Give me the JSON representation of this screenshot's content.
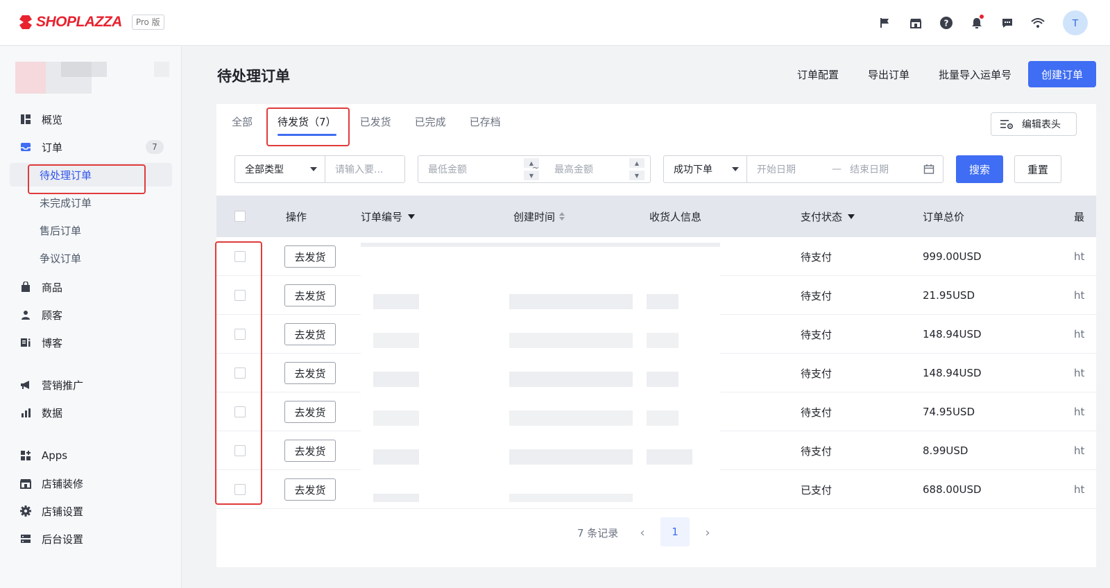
{
  "brand": {
    "name": "SHOPLAZZA",
    "edition": "Pro 版",
    "color": "#e8222f"
  },
  "topbar": {
    "icons": [
      "flag-icon",
      "store-icon",
      "help-icon",
      "bell-icon",
      "chat-icon",
      "wifi-icon"
    ],
    "avatar_letter": "T"
  },
  "sidebar": {
    "overview": "概览",
    "orders": "订单",
    "orders_count": "7",
    "orders_sub": [
      "待处理订单",
      "未完成订单",
      "售后订单",
      "争议订单"
    ],
    "products": "商品",
    "customers": "顾客",
    "blog": "博客",
    "marketing": "营销推广",
    "data": "数据",
    "apps": "Apps",
    "store_design": "店铺装修",
    "store_settings": "店铺设置",
    "admin_settings": "后台设置"
  },
  "page": {
    "title": "待处理订单",
    "actions": {
      "config": "订单配置",
      "export": "导出订单",
      "bulk_import": "批量导入运单号",
      "create": "创建订单"
    }
  },
  "tabs": [
    "全部",
    "待发货（7）",
    "已发货",
    "已完成",
    "已存档"
  ],
  "edit_columns": "编辑表头",
  "filters": {
    "type_select": "全部类型",
    "keyword_placeholder": "请输入要...",
    "min_amount_placeholder": "最低金额",
    "range_sep": "~",
    "max_amount_placeholder": "最高金额",
    "status_select": "成功下单",
    "start_date_placeholder": "开始日期",
    "date_sep": "—",
    "end_date_placeholder": "结束日期",
    "search": "搜索",
    "reset": "重置"
  },
  "table": {
    "headers": {
      "action": "操作",
      "order_no": "订单编号",
      "created": "创建时间",
      "receiver": "收货人信息",
      "pay_status": "支付状态",
      "total": "订单总价",
      "last": "最"
    },
    "rows": [
      {
        "action": "去发货",
        "pay_status": "待支付",
        "total": "999.00USD",
        "last": "ht"
      },
      {
        "action": "去发货",
        "pay_status": "待支付",
        "total": "21.95USD",
        "last": "ht"
      },
      {
        "action": "去发货",
        "pay_status": "待支付",
        "total": "148.94USD",
        "last": "ht"
      },
      {
        "action": "去发货",
        "pay_status": "待支付",
        "total": "148.94USD",
        "last": "ht"
      },
      {
        "action": "去发货",
        "pay_status": "待支付",
        "total": "74.95USD",
        "last": "ht"
      },
      {
        "action": "去发货",
        "pay_status": "待支付",
        "total": "8.99USD",
        "last": "ht"
      },
      {
        "action": "去发货",
        "pay_status": "已支付",
        "total": "688.00USD",
        "last": "ht"
      }
    ]
  },
  "pagination": {
    "summary": "7 条记录",
    "current_page": "1"
  },
  "colors": {
    "primary": "#3f6df3",
    "highlight": "#e03a3a"
  }
}
